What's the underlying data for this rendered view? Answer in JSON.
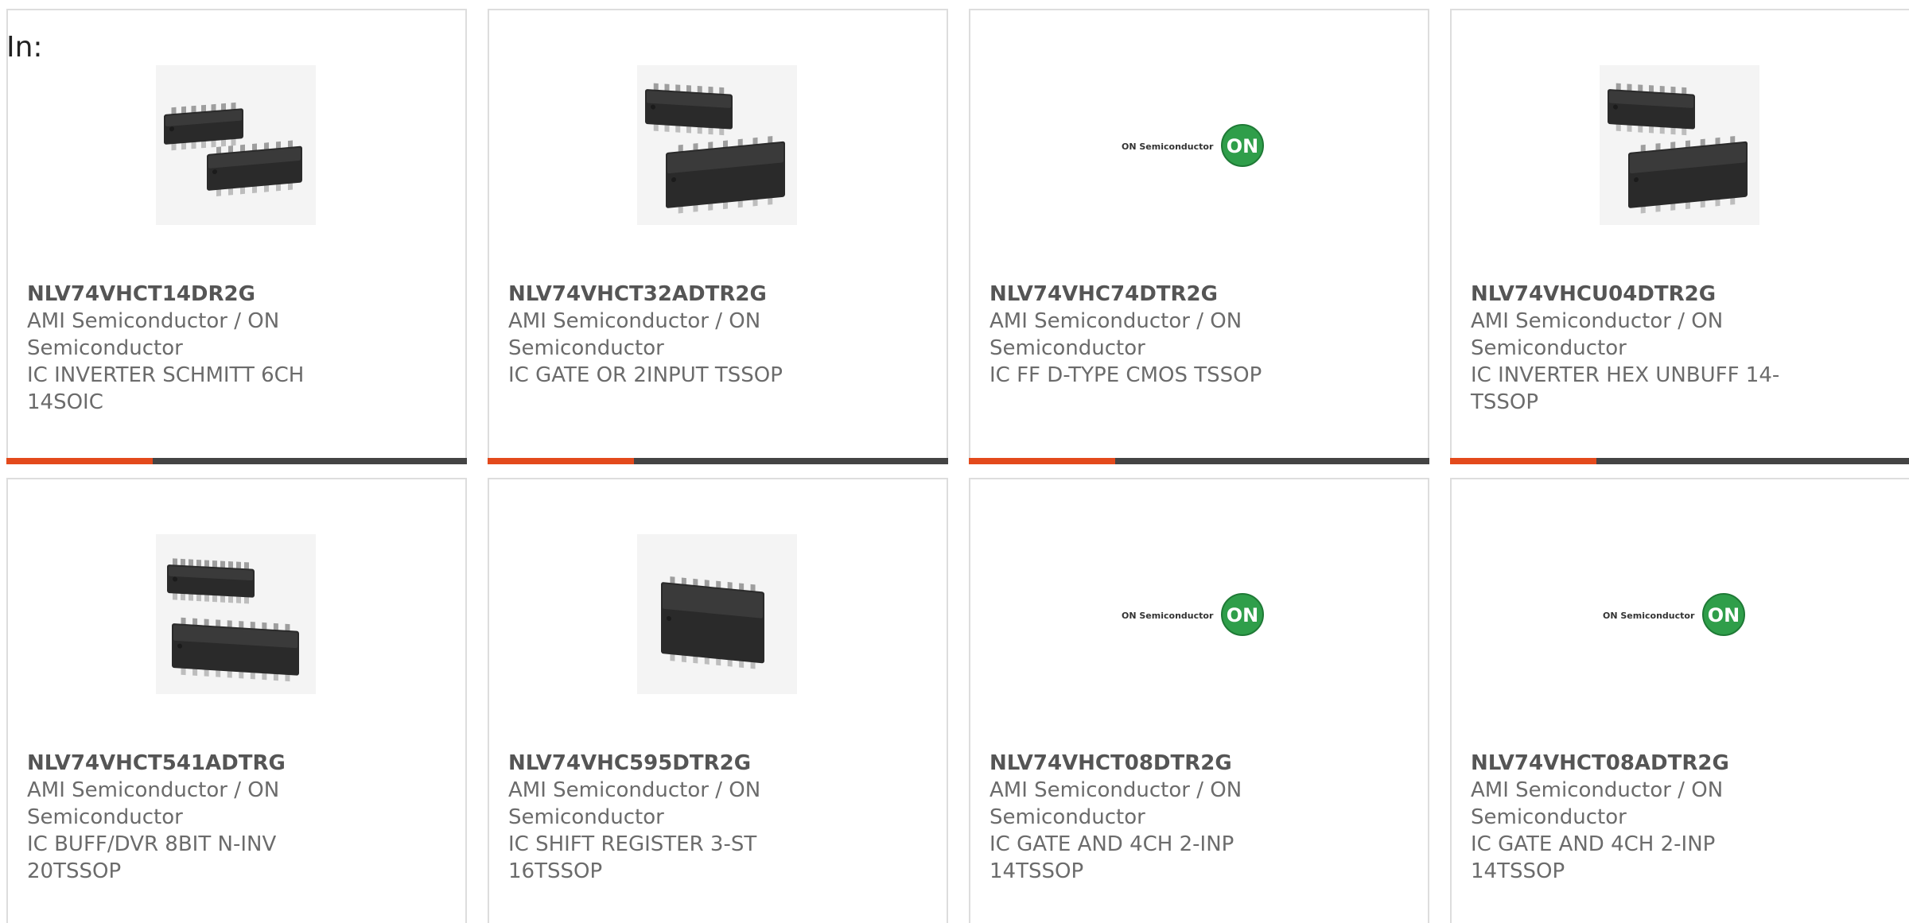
{
  "header": {
    "label": "In:"
  },
  "colors": {
    "accent": "#e34a1c",
    "bar": "#444444",
    "on_logo": "#2f9e4a"
  },
  "products": [
    {
      "part": "NLV74VHCT14DR2G",
      "manufacturer": "AMI Semiconductor / ON Semiconductor",
      "description": "IC INVERTER SCHMITT 6CH 14SOIC",
      "image": "soic-14-pair-icon"
    },
    {
      "part": "NLV74VHCT32ADTR2G",
      "manufacturer": "AMI Semiconductor / ON Semiconductor",
      "description": "IC GATE OR 2INPUT TSSOP",
      "image": "tssop-pair-icon"
    },
    {
      "part": "NLV74VHC74DTR2G",
      "manufacturer": "AMI Semiconductor / ON Semiconductor",
      "description": "IC FF D-TYPE CMOS TSSOP",
      "image": "on-semiconductor-logo",
      "logo_text": "ON Semiconductor",
      "logo_badge": "ON"
    },
    {
      "part": "NLV74VHCU04DTR2G",
      "manufacturer": "AMI Semiconductor / ON Semiconductor",
      "description": "IC INVERTER HEX UNBUFF 14-TSSOP",
      "image": "tssop-pair-icon"
    },
    {
      "part": "NLV74VHCT541ADTRG",
      "manufacturer": "AMI Semiconductor / ON Semiconductor",
      "description": "IC BUFF/DVR 8BIT N-INV 20TSSOP",
      "image": "tssop-20-pair-icon"
    },
    {
      "part": "NLV74VHC595DTR2G",
      "manufacturer": "AMI Semiconductor / ON Semiconductor",
      "description": "IC SHIFT REGISTER 3-ST 16TSSOP",
      "image": "tssop-16-icon"
    },
    {
      "part": "NLV74VHCT08DTR2G",
      "manufacturer": "AMI Semiconductor / ON Semiconductor",
      "description": "IC GATE AND 4CH 2-INP 14TSSOP",
      "image": "on-semiconductor-logo",
      "logo_text": "ON Semiconductor",
      "logo_badge": "ON"
    },
    {
      "part": "NLV74VHCT08ADTR2G",
      "manufacturer": "AMI Semiconductor / ON Semiconductor",
      "description": "IC GATE AND 4CH 2-INP 14TSSOP",
      "image": "on-semiconductor-logo",
      "logo_text": "ON Semiconductor",
      "logo_badge": "ON"
    }
  ]
}
